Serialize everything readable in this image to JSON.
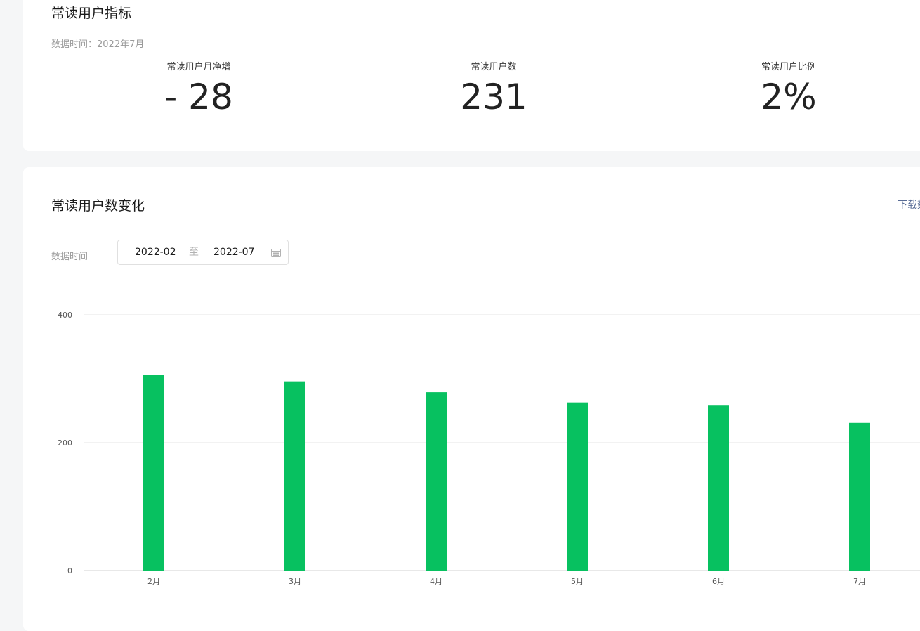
{
  "metrics_card": {
    "title": "常读用户指标",
    "data_time": "数据时间：2022年7月",
    "metrics": [
      {
        "label": "常读用户月净增",
        "value": "- 28"
      },
      {
        "label": "常读用户数",
        "value": "231"
      },
      {
        "label": "常读用户比例",
        "value": "2%"
      }
    ]
  },
  "trend_card": {
    "title": "常读用户数变化",
    "download_label": "下载数",
    "data_time_label": "数据时间",
    "date_start": "2022-02",
    "date_separator": "至",
    "date_end": "2022-07"
  },
  "colors": {
    "bar": "#07c160",
    "gridline": "#e6e6e6",
    "link": "#576b95"
  },
  "chart_data": {
    "type": "bar",
    "categories": [
      "2月",
      "3月",
      "4月",
      "5月",
      "6月",
      "7月"
    ],
    "values": [
      306,
      296,
      279,
      263,
      258,
      231
    ],
    "ylim": [
      0,
      400
    ],
    "yticks": [
      0,
      200,
      400
    ],
    "title": "",
    "xlabel": "",
    "ylabel": "",
    "grid": true,
    "legend": "none"
  }
}
